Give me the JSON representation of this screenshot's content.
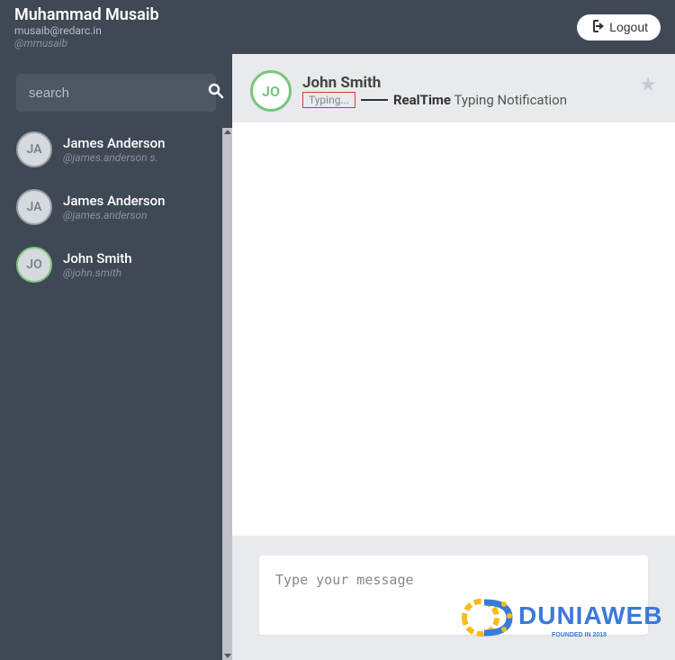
{
  "header": {
    "user_name": "Muhammad Musaib",
    "user_email": "musaib@redarc.in",
    "user_handle": "@mmusaib",
    "logout_label": "Logout"
  },
  "sidebar": {
    "search_placeholder": "search",
    "contacts": [
      {
        "initials": "JA",
        "name": "James Anderson",
        "handle": "@james.anderson s.",
        "online": false
      },
      {
        "initials": "JA",
        "name": "James Anderson",
        "handle": "@james.anderson",
        "online": false
      },
      {
        "initials": "JO",
        "name": "John Smith",
        "handle": "@john.smith",
        "online": true
      }
    ]
  },
  "chat": {
    "avatar_initials": "JO",
    "title": "John Smith",
    "typing_text": "Typing...",
    "annotation_bold": "RealTime",
    "annotation_rest": " Typing Notification"
  },
  "compose": {
    "placeholder": "Type your message"
  },
  "watermark": {
    "text": "DUNIAWEB",
    "sub": "FOUNDED IN 2018"
  }
}
